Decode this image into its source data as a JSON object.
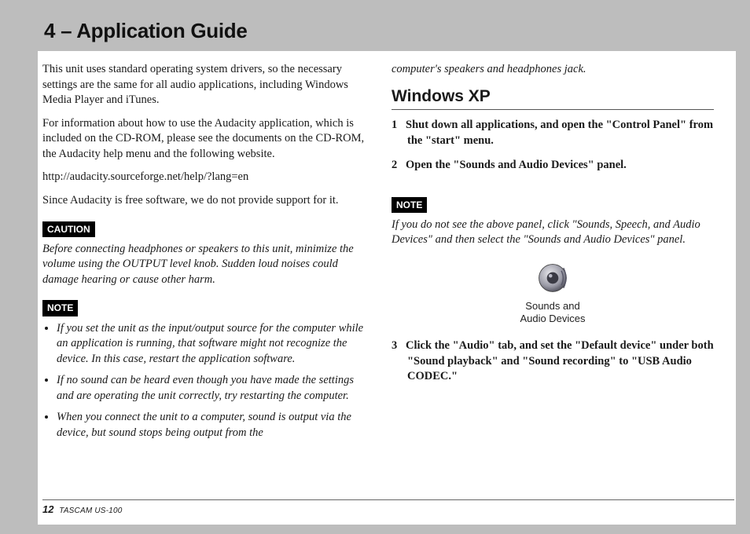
{
  "header": {
    "title": "4 – Application Guide"
  },
  "left": {
    "p1": "This unit uses standard operating system drivers, so the necessary settings are the same for all audio applications, including Windows Media Player and iTunes.",
    "p2": "For information about how to use the Audacity application, which is included on the CD-ROM, please see the documents on the CD-ROM, the Audacity help menu and the following website.",
    "url": "http://audacity.sourceforge.net/help/?lang=en",
    "p3": "Since Audacity is free software, we do not provide support for it.",
    "caution_label": "CAUTION",
    "caution_text": "Before connecting headphones or speakers to this unit, minimize the volume using the OUTPUT level knob. Sudden loud noises could damage hearing or cause other harm.",
    "note_label": "NOTE",
    "notes": [
      "If you set the unit as the input/output source for the computer while an application is running, that software might not recognize the device. In this case, restart the application software.",
      "If no sound can be heard even though you have made the settings and are operating the unit correctly, try restarting the computer.",
      "When you connect the unit to a computer, sound is output via the device, but sound stops being output from the"
    ]
  },
  "right": {
    "carryover": "computer's speakers and headphones jack.",
    "section": "Windows XP",
    "steps_a": [
      "Shut down all applications, and open the \"Control Panel\" from the \"start\" menu.",
      "Open the \"Sounds and Audio Devices\" panel."
    ],
    "note_label": "NOTE",
    "note_text": "If you do not see the above panel, click \"Sounds, Speech, and Audio Devices\" and then select the \"Sounds and Audio Devices\" panel.",
    "icon_caption_l1": "Sounds and",
    "icon_caption_l2": "Audio Devices",
    "step3": "Click the \"Audio\" tab, and set the \"Default device\" under both \"Sound playback\" and \"Sound recording\" to \"USB Audio CODEC.\""
  },
  "footer": {
    "page": "12",
    "model": "TASCAM US-100"
  }
}
